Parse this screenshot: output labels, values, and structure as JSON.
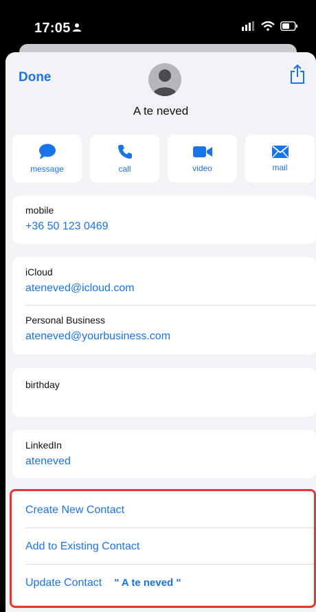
{
  "status": {
    "time": "17:05"
  },
  "header": {
    "done_label": "Done",
    "contact_name": "A te neved"
  },
  "actions": [
    {
      "label": "message",
      "icon": "message-bubble-icon"
    },
    {
      "label": "call",
      "icon": "phone-icon"
    },
    {
      "label": "video",
      "icon": "video-camera-icon"
    },
    {
      "label": "mail",
      "icon": "mail-envelope-icon"
    }
  ],
  "phone": {
    "label": "mobile",
    "value": "+36 50 123 0469"
  },
  "emails": [
    {
      "label": "iCloud",
      "value": "ateneved@icloud.com"
    },
    {
      "label": "Personal Business",
      "value": "ateneved@yourbusiness.com"
    }
  ],
  "birthday": {
    "label": "birthday",
    "value": ""
  },
  "social": {
    "label": "LinkedIn",
    "value": "ateneved"
  },
  "contact_actions": {
    "create": "Create New Contact",
    "add_existing": "Add to Existing Contact",
    "update": "Update Contact",
    "update_name": "\" A te neved \""
  },
  "colors": {
    "accent": "#1a73e8",
    "highlight": "#e8352f",
    "background": "#f2f2f7"
  }
}
